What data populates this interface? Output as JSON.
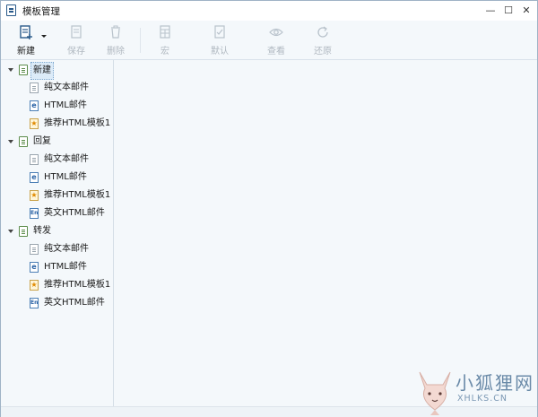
{
  "window": {
    "title": "模板管理",
    "minimize": "—",
    "maximize": "☐",
    "close": "✕"
  },
  "toolbar": {
    "new_label": "新建",
    "save_label": "保存",
    "delete_label": "删除",
    "macro_label": "宏",
    "default_label": "默认",
    "view_label": "查看",
    "restore_label": "还原"
  },
  "tree": {
    "groups": [
      {
        "label": "新建",
        "items": [
          {
            "label": "纯文本邮件",
            "icon": "text-document-icon"
          },
          {
            "label": "HTML邮件",
            "icon": "html-document-icon"
          },
          {
            "label": "推荐HTML模板1",
            "icon": "star-document-icon"
          }
        ]
      },
      {
        "label": "回复",
        "items": [
          {
            "label": "纯文本邮件",
            "icon": "text-document-icon"
          },
          {
            "label": "HTML邮件",
            "icon": "html-document-icon"
          },
          {
            "label": "推荐HTML模板1",
            "icon": "star-document-icon"
          },
          {
            "label": "英文HTML邮件",
            "icon": "en-document-icon"
          }
        ]
      },
      {
        "label": "转发",
        "items": [
          {
            "label": "纯文本邮件",
            "icon": "text-document-icon"
          },
          {
            "label": "HTML邮件",
            "icon": "html-document-icon"
          },
          {
            "label": "推荐HTML模板1",
            "icon": "star-document-icon"
          },
          {
            "label": "英文HTML邮件",
            "icon": "en-document-icon"
          }
        ]
      }
    ]
  },
  "icon_glyphs": {
    "html": "e",
    "star": "★",
    "en": "En"
  },
  "watermark": {
    "text": "小狐狸网",
    "url": "XHLKS.CN"
  },
  "colors": {
    "accent": "#2a5a8a",
    "disabled_text": "#b0b8c0",
    "selection": "#dcebf8"
  }
}
